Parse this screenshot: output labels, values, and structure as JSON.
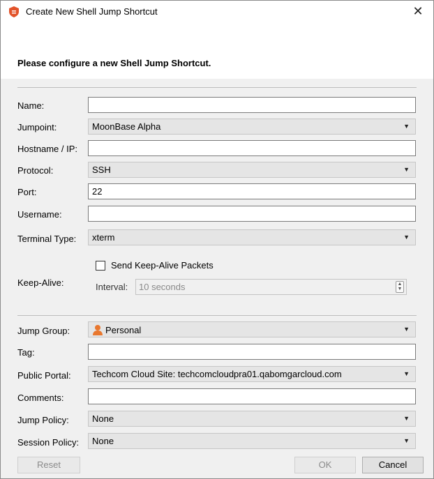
{
  "window": {
    "title": "Create New Shell Jump Shortcut",
    "close_glyph": "✕"
  },
  "header": {
    "text": "Please configure a new Shell Jump Shortcut."
  },
  "form": {
    "name": {
      "label": "Name:",
      "value": ""
    },
    "jumpoint": {
      "label": "Jumpoint:",
      "value": "MoonBase Alpha"
    },
    "hostname": {
      "label": "Hostname / IP:",
      "value": ""
    },
    "protocol": {
      "label": "Protocol:",
      "value": "SSH"
    },
    "port": {
      "label": "Port:",
      "value": "22"
    },
    "username": {
      "label": "Username:",
      "value": ""
    },
    "terminal_type": {
      "label": "Terminal Type:",
      "value": "xterm"
    },
    "keep_alive": {
      "label": "Keep-Alive:",
      "checkbox_label": "Send Keep-Alive Packets",
      "checked": false,
      "interval_label": "Interval:",
      "interval_value": "10 seconds"
    },
    "jump_group": {
      "label": "Jump Group:",
      "value": "Personal",
      "icon": "user-icon"
    },
    "tag": {
      "label": "Tag:",
      "value": ""
    },
    "public_portal": {
      "label": "Public Portal:",
      "value": "Techcom Cloud Site: techcomcloudpra01.qabomgarcloud.com"
    },
    "comments": {
      "label": "Comments:",
      "value": ""
    },
    "jump_policy": {
      "label": "Jump Policy:",
      "value": "None"
    },
    "session_policy": {
      "label": "Session Policy:",
      "value": "None"
    }
  },
  "buttons": {
    "reset": "Reset",
    "ok": "OK",
    "cancel": "Cancel"
  },
  "colors": {
    "brand_icon": "#e2532a",
    "user_icon": "#e8772e"
  }
}
